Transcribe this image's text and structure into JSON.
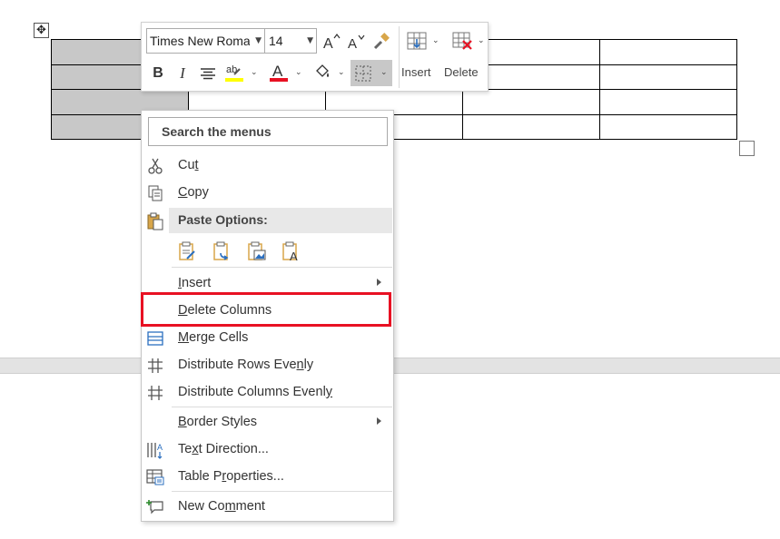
{
  "mini_toolbar": {
    "font_name": "Times New Roman",
    "font_size": "14",
    "insert_label": "Insert",
    "delete_label": "Delete",
    "icons": [
      "grow-font-icon",
      "shrink-font-icon",
      "format-painter-icon",
      "bold-icon",
      "italic-icon",
      "center-align-icon",
      "highlight-icon",
      "font-color-icon",
      "shading-icon",
      "borders-icon",
      "insert-table-icon",
      "delete-table-icon"
    ],
    "highlight_color": "#ffff00",
    "font_color": "#e81123"
  },
  "context_menu": {
    "search_placeholder": "Search the menus",
    "paste_options_label": "Paste Options:",
    "items": {
      "cut": {
        "pre": "Cu",
        "key": "t",
        "post": ""
      },
      "copy": {
        "pre": "",
        "key": "C",
        "post": "opy"
      },
      "insert": {
        "pre": "",
        "key": "I",
        "post": "nsert"
      },
      "delete_columns": {
        "pre": "",
        "key": "D",
        "post": "elete Columns"
      },
      "merge_cells": {
        "pre": "",
        "key": "M",
        "post": "erge Cells"
      },
      "distribute_rows": {
        "pre": "Distribute Rows Eve",
        "key": "n",
        "post": "ly"
      },
      "distribute_columns": {
        "pre": "Distribute Columns Evenl",
        "key": "y",
        "post": ""
      },
      "border_styles": {
        "pre": "",
        "key": "B",
        "post": "order Styles"
      },
      "text_direction": {
        "pre": "Te",
        "key": "x",
        "post": "t Direction..."
      },
      "table_properties": {
        "pre": "Table P",
        "key": "r",
        "post": "operties..."
      },
      "new_comment": {
        "pre": "New Co",
        "key": "m",
        "post": "ment"
      }
    }
  },
  "highlight_color": "#e81123"
}
